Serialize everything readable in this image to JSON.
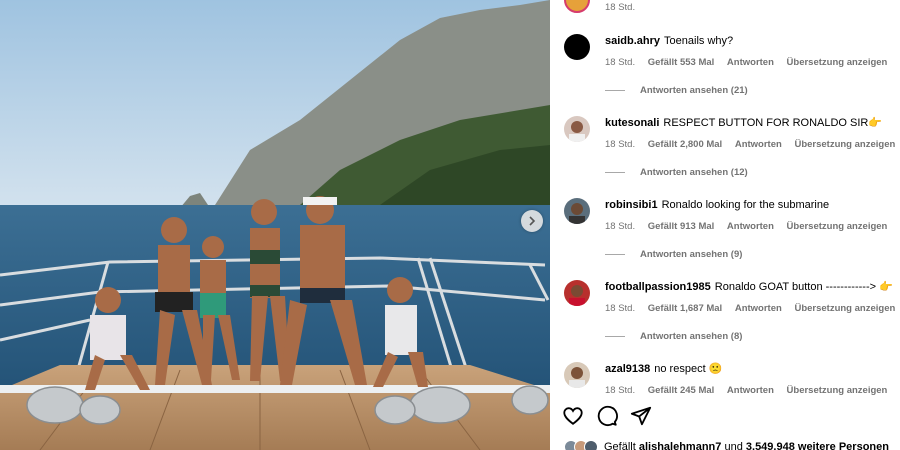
{
  "photo": {
    "alt_icon": "image-photo",
    "next_icon": "chevron-right-icon"
  },
  "top_comment": {
    "time": "18 Std."
  },
  "comments": [
    {
      "user": "saidb.ahry",
      "text": "Toenails why?",
      "time": "18 Std.",
      "likes": "Gefällt 553 Mal",
      "reply": "Antworten",
      "translate": "Übersetzung anzeigen",
      "view_replies": "Antworten ansehen (21)"
    },
    {
      "user": "kutesonali",
      "text": "RESPECT BUTTON FOR RONALDO SIR👉",
      "time": "18 Std.",
      "likes": "Gefällt 2,800 Mal",
      "reply": "Antworten",
      "translate": "Übersetzung anzeigen",
      "view_replies": "Antworten ansehen (12)"
    },
    {
      "user": "robinsibi1",
      "text": "Ronaldo looking for the submarine",
      "time": "18 Std.",
      "likes": "Gefällt 913 Mal",
      "reply": "Antworten",
      "translate": "Übersetzung anzeigen",
      "view_replies": "Antworten ansehen (9)"
    },
    {
      "user": "footballpassion1985",
      "text": "Ronaldo GOAT button ------------> 👉",
      "time": "18 Std.",
      "likes": "Gefällt 1,687 Mal",
      "reply": "Antworten",
      "translate": "Übersetzung anzeigen",
      "view_replies": "Antworten ansehen (8)"
    },
    {
      "user": "azal9138",
      "text": "no respect 🙁",
      "time": "18 Std.",
      "likes": "Gefällt 245 Mal",
      "reply": "Antworten",
      "translate": "Übersetzung anzeigen"
    }
  ],
  "actions": {
    "like_icon": "heart-icon",
    "comment_icon": "comment-icon",
    "share_icon": "send-icon"
  },
  "liked_by": {
    "prefix": "Gefällt",
    "user": "alishalehmann7",
    "middle": "und",
    "count": "3.549.948 weitere Personen"
  }
}
